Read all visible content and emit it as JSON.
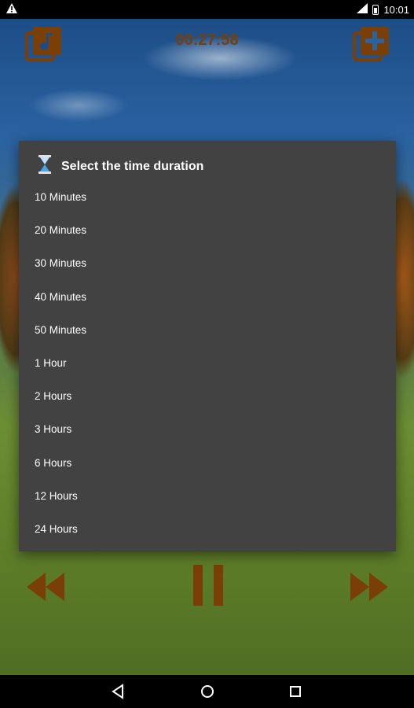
{
  "status_bar": {
    "time": "10:01",
    "icons": [
      "warning-icon",
      "signal-icon",
      "battery-icon"
    ]
  },
  "player": {
    "timer": "00:27:58",
    "accent_color": "#7a3f06"
  },
  "dialog": {
    "title": "Select the time duration",
    "icon": "hourglass-icon",
    "options": [
      "10 Minutes",
      "20 Minutes",
      "30 Minutes",
      "40 Minutes",
      "50 Minutes",
      "1 Hour",
      "2 Hours",
      "3 Hours",
      "6 Hours",
      "12 Hours",
      "24 Hours"
    ]
  },
  "nav_bar": {
    "icons": [
      "back-icon",
      "home-icon",
      "recent-apps-icon"
    ]
  }
}
